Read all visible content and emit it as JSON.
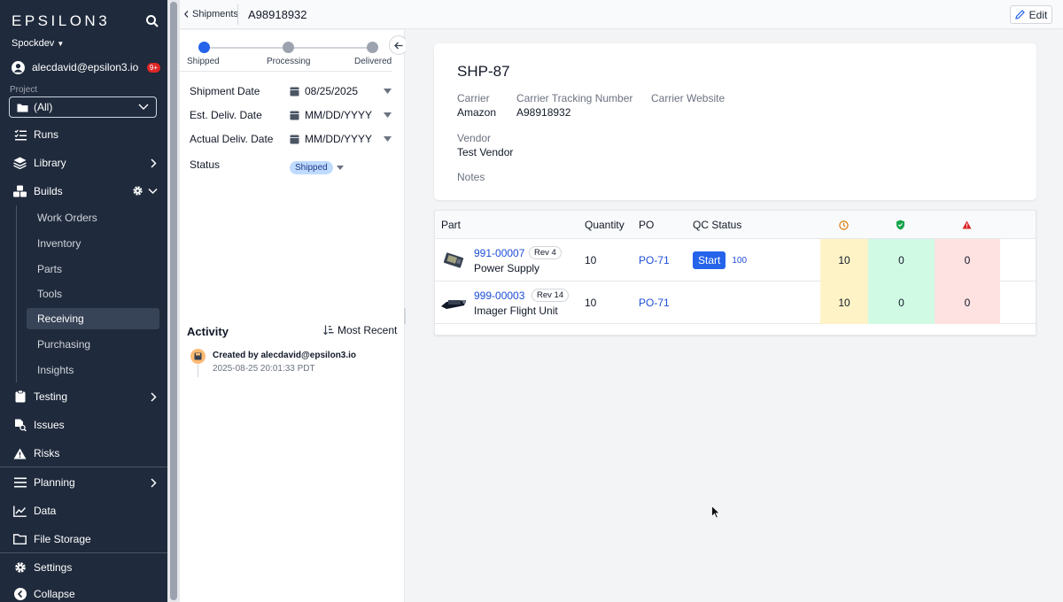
{
  "sidebar": {
    "brand": "EPSILON3",
    "workspace": "Spockdev",
    "user": {
      "email": "alecdavid@epsilon3.io",
      "badge": "9+"
    },
    "project": {
      "label": "Project",
      "value": "(All)"
    },
    "nav": {
      "runs": "Runs",
      "library": "Library",
      "builds": "Builds",
      "testing": "Testing",
      "issues": "Issues",
      "risks": "Risks",
      "planning": "Planning",
      "data": "Data",
      "file_storage": "File Storage",
      "settings": "Settings",
      "collapse": "Collapse"
    },
    "builds_sub": [
      "Work Orders",
      "Inventory",
      "Parts",
      "Tools",
      "Receiving",
      "Purchasing",
      "Insights"
    ],
    "active_sub": "Receiving"
  },
  "topbar": {
    "breadcrumb": "Shipments",
    "current_id": "A98918932",
    "edit_label": "Edit"
  },
  "stepper": {
    "steps": [
      "Shipped",
      "Processing",
      "Delivered"
    ],
    "current": "Shipped"
  },
  "fields": {
    "shipment_date": {
      "label": "Shipment Date",
      "value": "08/25/2025"
    },
    "est_delivery": {
      "label": "Est. Deliv. Date",
      "value": "MM/DD/YYYY"
    },
    "actual_delivery": {
      "label": "Actual Deliv. Date",
      "value": "MM/DD/YYYY"
    },
    "status": {
      "label": "Status",
      "value": "Shipped"
    }
  },
  "activity": {
    "title": "Activity",
    "sort_label": "Most Recent",
    "entries": [
      {
        "text": "Created by alecdavid@epsilon3.io",
        "time": "2025-08-25 20:01:33 PDT"
      }
    ]
  },
  "shipment": {
    "id": "SHP-87",
    "carrier_label": "Carrier",
    "carrier": "Amazon",
    "tracking_label": "Carrier Tracking Number",
    "tracking": "A98918932",
    "website_label": "Carrier Website",
    "vendor_label": "Vendor",
    "vendor": "Test Vendor",
    "notes_label": "Notes"
  },
  "table": {
    "headers": {
      "part": "Part",
      "quantity": "Quantity",
      "po": "PO",
      "qc_status": "QC Status"
    },
    "rows": [
      {
        "part_number": "991-00007",
        "rev": "Rev 4",
        "name": "Power Supply",
        "quantity": "10",
        "po": "PO-71",
        "qc_action": "Start",
        "qc_count": "100",
        "pending": "10",
        "passed": "0",
        "failed": "0"
      },
      {
        "part_number": "999-00003",
        "rev": "Rev 14",
        "name": "Imager Flight Unit",
        "quantity": "10",
        "po": "PO-71",
        "qc_action": "",
        "qc_count": "",
        "pending": "10",
        "passed": "0",
        "failed": "0"
      }
    ]
  },
  "colors": {
    "sidebar_bg": "#1f2a3c",
    "accent": "#2563eb",
    "pending": "#fef3c7",
    "passed": "#d1fae5",
    "failed": "#fee2e2"
  }
}
